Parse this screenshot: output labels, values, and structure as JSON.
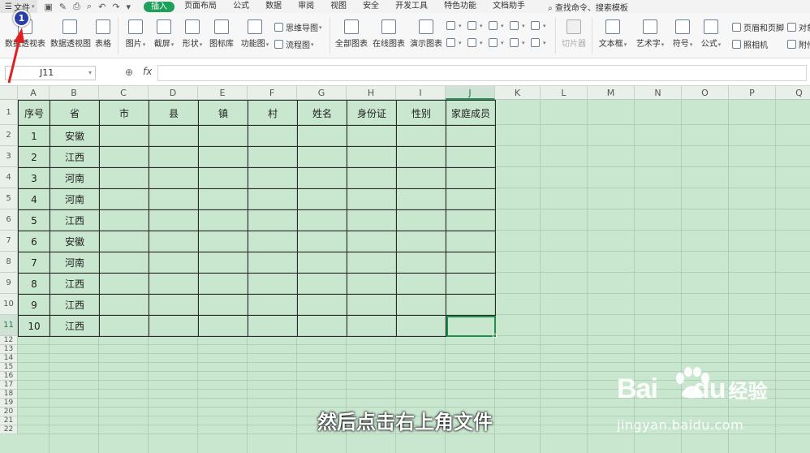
{
  "menubar": {
    "file_label": "文件",
    "tabs": [
      {
        "label": "插入",
        "active": true
      },
      {
        "label": "页面布局",
        "active": false
      },
      {
        "label": "公式",
        "active": false
      },
      {
        "label": "数据",
        "active": false
      },
      {
        "label": "审阅",
        "active": false
      },
      {
        "label": "视图",
        "active": false
      },
      {
        "label": "安全",
        "active": false
      },
      {
        "label": "开发工具",
        "active": false
      },
      {
        "label": "特色功能",
        "active": false
      },
      {
        "label": "文档助手",
        "active": false
      }
    ],
    "search": "查找命令、搜索模板"
  },
  "ribbon": {
    "pivot_table": "数据透视表",
    "pivot_chart": "数据透视图",
    "table": "表格",
    "picture": "图片",
    "screenshot": "截屏",
    "shape": "形状",
    "icon_lib": "图标库",
    "function_chart": "功能图",
    "mind_map": "思维导图",
    "flow_chart": "流程图",
    "all_charts": "全部图表",
    "online_charts": "在线图表",
    "demo_charts": "演示图表",
    "slicer": "切片器",
    "textbox": "文本框",
    "wordart": "艺术字",
    "symbol": "符号",
    "formula": "公式",
    "header_footer": "页眉和页脚",
    "camera": "照相机",
    "object": "对象",
    "attachment": "附件"
  },
  "formula_bar": {
    "cell_ref": "J11",
    "fx": "fx",
    "value": ""
  },
  "columns": [
    "A",
    "B",
    "C",
    "D",
    "E",
    "F",
    "G",
    "H",
    "I",
    "J",
    "K",
    "L",
    "M",
    "N",
    "O",
    "P",
    "Q"
  ],
  "selected_column": "J",
  "row_numbers": [
    "1",
    "2",
    "3",
    "4",
    "5",
    "6",
    "7",
    "8",
    "9",
    "10",
    "11",
    "12",
    "13",
    "14",
    "15",
    "16",
    "17",
    "18",
    "19",
    "20",
    "21",
    "22"
  ],
  "selected_row": "11",
  "table": {
    "headers": [
      "序号",
      "省",
      "市",
      "县",
      "镇",
      "村",
      "姓名",
      "身份证",
      "性别",
      "家庭成员"
    ],
    "rows": [
      [
        "1",
        "安徽",
        "",
        "",
        "",
        "",
        "",
        "",
        "",
        ""
      ],
      [
        "2",
        "江西",
        "",
        "",
        "",
        "",
        "",
        "",
        "",
        ""
      ],
      [
        "3",
        "河南",
        "",
        "",
        "",
        "",
        "",
        "",
        "",
        ""
      ],
      [
        "4",
        "河南",
        "",
        "",
        "",
        "",
        "",
        "",
        "",
        ""
      ],
      [
        "5",
        "江西",
        "",
        "",
        "",
        "",
        "",
        "",
        "",
        ""
      ],
      [
        "6",
        "安徽",
        "",
        "",
        "",
        "",
        "",
        "",
        "",
        ""
      ],
      [
        "7",
        "河南",
        "",
        "",
        "",
        "",
        "",
        "",
        "",
        ""
      ],
      [
        "8",
        "江西",
        "",
        "",
        "",
        "",
        "",
        "",
        "",
        ""
      ],
      [
        "9",
        "江西",
        "",
        "",
        "",
        "",
        "",
        "",
        "",
        ""
      ],
      [
        "10",
        "江西",
        "",
        "",
        "",
        "",
        "",
        "",
        "",
        ""
      ]
    ]
  },
  "annotation": {
    "step_number": "1",
    "marker_color": "#2a3ea8",
    "arrow_color": "#e02020"
  },
  "subtitle": "然后点击右上角文件",
  "watermark": {
    "brand": "Bai",
    "brand_tail": "du",
    "cn": "经验",
    "url": "jingyan.baidu.com"
  },
  "colors": {
    "accent": "#1e9f5a",
    "sheet_bg": "#c9e6cf"
  }
}
